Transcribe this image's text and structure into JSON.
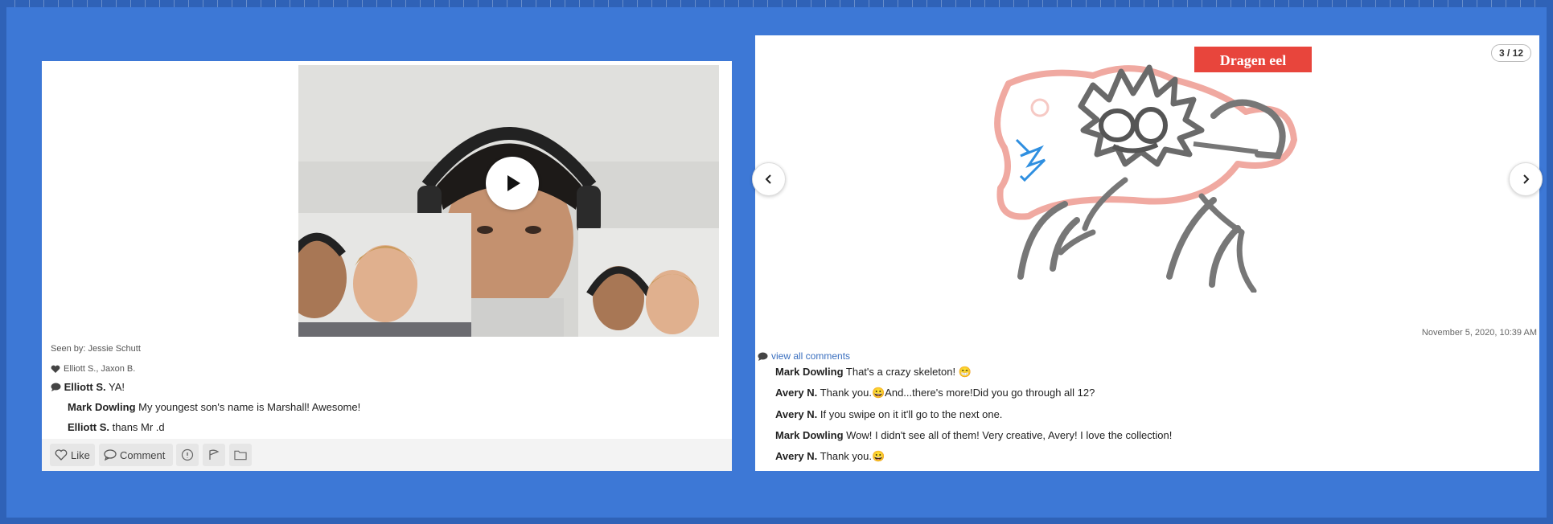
{
  "left_post": {
    "seen_by": "Seen by: Jessie Schutt",
    "likes": "Elliott S., Jaxon B.",
    "comments": [
      {
        "author": "Elliott S.",
        "text": "YA!"
      },
      {
        "author": "Mark Dowling",
        "text": "My youngest son's name is Marshall! Awesome!"
      },
      {
        "author": "Elliott S.",
        "text": "thans Mr .d"
      }
    ],
    "toolbar": {
      "like_label": "Like",
      "comment_label": "Comment"
    }
  },
  "right_post": {
    "drawing_title": "Dragen eel",
    "page_indicator": "3 / 12",
    "timestamp": "November 5, 2020, 10:39 AM",
    "view_all_label": "view all comments",
    "comments": [
      {
        "author": "Mark Dowling",
        "text": "That's a crazy skeleton! 😁"
      },
      {
        "author": "Avery N.",
        "text": "Thank you.😀And...there's more!Did you go through all 12?"
      },
      {
        "author": "Avery N.",
        "text": "If you swipe on it it'll go to the next one."
      },
      {
        "author": "Mark Dowling",
        "text": "Wow! I didn't see all of them! Very creative, Avery! I love the collection!"
      },
      {
        "author": "Avery N.",
        "text": "Thank you.😀"
      }
    ]
  },
  "colors": {
    "background": "#3d78d6",
    "link": "#3a6fbf",
    "title_banner": "#e8453c"
  },
  "icons": [
    "play-icon",
    "heart-icon",
    "comment-bubble-icon",
    "chevron-left-icon",
    "chevron-right-icon"
  ]
}
